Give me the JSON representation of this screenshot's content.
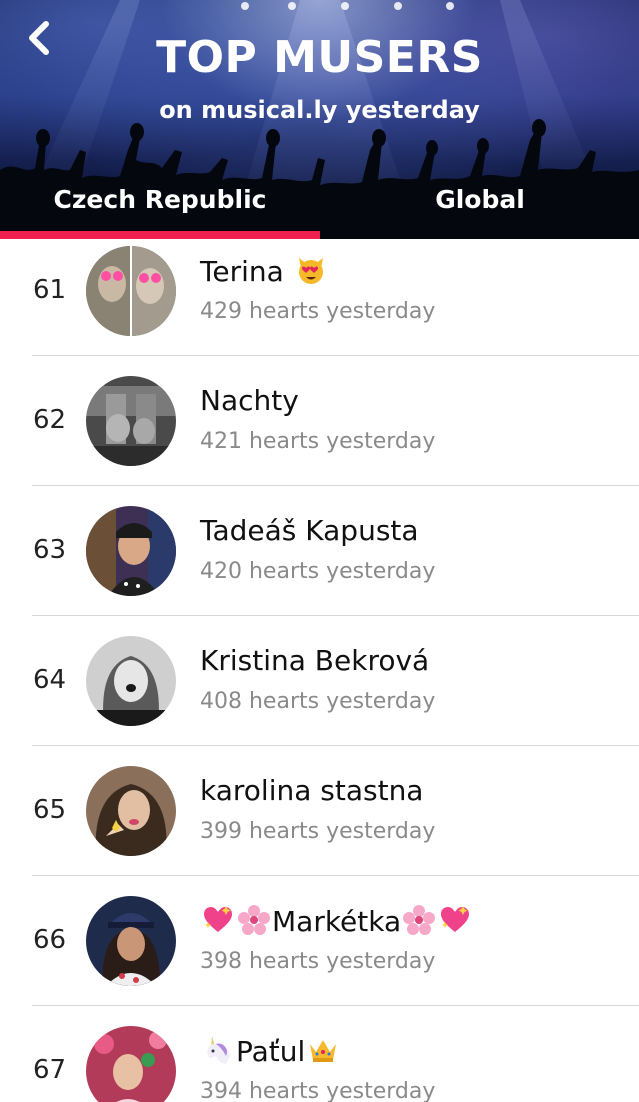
{
  "header": {
    "title": "TOP MUSERS",
    "subtitle": "on musical.ly yesterday",
    "back_icon": "chevron-left-icon"
  },
  "tabs": [
    {
      "label": "Czech Republic",
      "active": true
    },
    {
      "label": "Global",
      "active": false
    }
  ],
  "colors": {
    "accent": "#f0204f",
    "hearts_text": "#8a8a8a",
    "divider": "#d8d8d8"
  },
  "rows": [
    {
      "rank": "61",
      "name": "Terina",
      "name_emoji_after": "heart-eyes-cat-emoji",
      "hearts": "429 hearts yesterday"
    },
    {
      "rank": "62",
      "name": "Nachty",
      "hearts": "421 hearts yesterday"
    },
    {
      "rank": "63",
      "name": "Tadeáš Kapusta",
      "hearts": "420 hearts yesterday"
    },
    {
      "rank": "64",
      "name": "Kristina Bekrová",
      "hearts": "408 hearts yesterday"
    },
    {
      "rank": "65",
      "name": "karolina stastna",
      "hearts": "399 hearts yesterday"
    },
    {
      "rank": "66",
      "name": "Markétka",
      "name_emoji_before": [
        "sparkling-heart-emoji",
        "cherry-blossom-emoji"
      ],
      "name_emoji_after": [
        "cherry-blossom-emoji",
        "sparkling-heart-emoji"
      ],
      "hearts": "398 hearts yesterday"
    },
    {
      "rank": "67",
      "name": "Paťul",
      "name_emoji_before": [
        "unicorn-emoji"
      ],
      "name_emoji_after": [
        "crown-emoji"
      ],
      "hearts": "394 hearts yesterday"
    }
  ]
}
